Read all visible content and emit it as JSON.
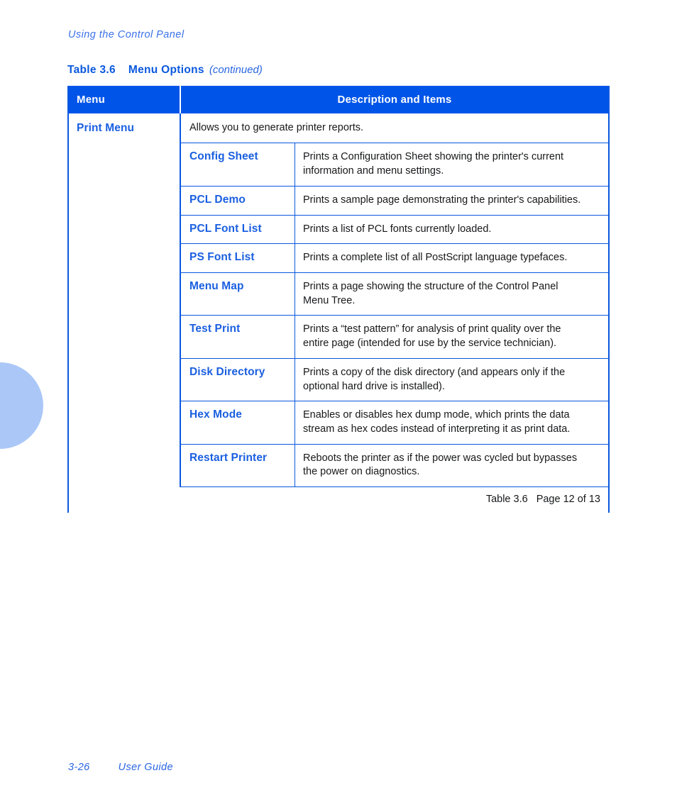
{
  "page": {
    "running_header": "Using the Control Panel",
    "footer_page_number": "3-26",
    "footer_doc_title": "User Guide"
  },
  "caption": {
    "number": "Table 3.6",
    "title": "Menu Options",
    "continued": "(continued)"
  },
  "colors": {
    "header_bar": "#0055E8",
    "border": "#0A58DE",
    "item_label": "#1A5FE0",
    "running_header": "#3A71E8",
    "thumb_tab": "#AAC7F7",
    "body_text": "#17181A"
  },
  "table": {
    "columns": {
      "menu": "Menu",
      "description": "Description and Items"
    },
    "menu_name": "Print Menu",
    "intro": "Allows you to generate printer reports.",
    "items": [
      {
        "label": "Config Sheet",
        "lines": [
          "Prints a Configuration Sheet showing the printer's current",
          "information and menu settings."
        ]
      },
      {
        "label": "PCL Demo",
        "lines": [
          "Prints a sample page demonstrating the printer's capabilities."
        ]
      },
      {
        "label": "PCL Font List",
        "lines": [
          "Prints a list of PCL fonts currently loaded."
        ]
      },
      {
        "label": "PS Font List",
        "lines": [
          "Prints a complete list of all PostScript language typefaces."
        ]
      },
      {
        "label": "Menu Map",
        "lines": [
          "Prints a page showing the structure of the Control Panel",
          "Menu Tree."
        ]
      },
      {
        "label": "Test Print",
        "lines": [
          "Prints a “test pattern” for analysis of print quality over the",
          "entire page (intended for use by the service technician)."
        ]
      },
      {
        "label": "Disk Directory",
        "lines": [
          "Prints a copy of the disk directory (and appears only if the",
          "optional hard drive is installed)."
        ]
      },
      {
        "label": "Hex Mode",
        "lines": [
          "Enables or disables hex dump mode, which prints the data",
          "stream as hex codes instead of interpreting it as print data."
        ]
      },
      {
        "label": "Restart Printer",
        "lines": [
          "Reboots the printer as if the power was cycled but bypasses",
          "the power on diagnostics."
        ]
      }
    ],
    "footer": {
      "table_ref": "Table 3.6",
      "pagination": "Page 12 of 13"
    }
  }
}
